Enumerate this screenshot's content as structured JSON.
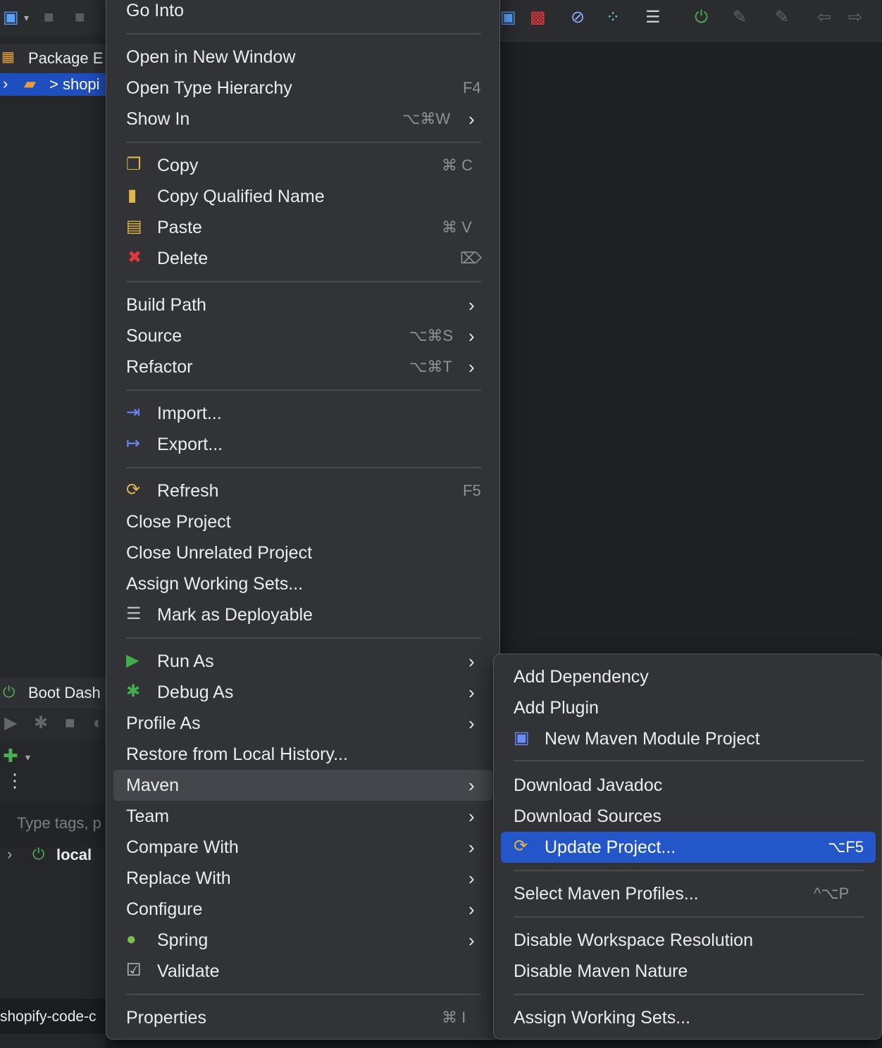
{
  "left_panel": {
    "package_explorer_title": "Package E",
    "project_row_label": "> shopi",
    "boot_dash_title": "Boot Dash",
    "search_placeholder": "Type tags, p",
    "local_label": "local",
    "bottom_tab_label": "shopify-code-c"
  },
  "main_menu": {
    "go_into": "Go Into",
    "open_new_window": "Open in New Window",
    "open_type_hierarchy": "Open Type Hierarchy",
    "open_type_hierarchy_sc": "F4",
    "show_in": "Show In",
    "show_in_sc": "⌥⌘W",
    "copy": "Copy",
    "copy_sc": "⌘ C",
    "copy_qualified": "Copy Qualified Name",
    "paste": "Paste",
    "paste_sc": "⌘ V",
    "delete": "Delete",
    "delete_sc": "⌦",
    "build_path": "Build Path",
    "source": "Source",
    "source_sc": "⌥⌘S",
    "refactor": "Refactor",
    "refactor_sc": "⌥⌘T",
    "import": "Import...",
    "export": "Export...",
    "refresh": "Refresh",
    "refresh_sc": "F5",
    "close_project": "Close Project",
    "close_unrelated": "Close Unrelated Project",
    "assign_working_sets": "Assign Working Sets...",
    "mark_deployable": "Mark as Deployable",
    "run_as": "Run As",
    "debug_as": "Debug As",
    "profile_as": "Profile As",
    "restore_history": "Restore from Local History...",
    "maven": "Maven",
    "team": "Team",
    "compare_with": "Compare With",
    "replace_with": "Replace With",
    "configure": "Configure",
    "spring": "Spring",
    "validate": "Validate",
    "properties": "Properties",
    "properties_sc": "⌘ I"
  },
  "maven_submenu": {
    "add_dependency": "Add Dependency",
    "add_plugin": "Add Plugin",
    "new_module": "New Maven Module Project",
    "download_javadoc": "Download Javadoc",
    "download_sources": "Download Sources",
    "update_project": "Update Project...",
    "update_project_sc": "⌥F5",
    "select_profiles": "Select Maven Profiles...",
    "select_profiles_sc": "^⌥P",
    "disable_workspace": "Disable Workspace Resolution",
    "disable_nature": "Disable Maven Nature",
    "assign_working_sets": "Assign Working Sets..."
  },
  "colors": {
    "highlight_blue": "#2356c8",
    "highlight_grey": "#45464b",
    "menu_bg": "#323337"
  }
}
